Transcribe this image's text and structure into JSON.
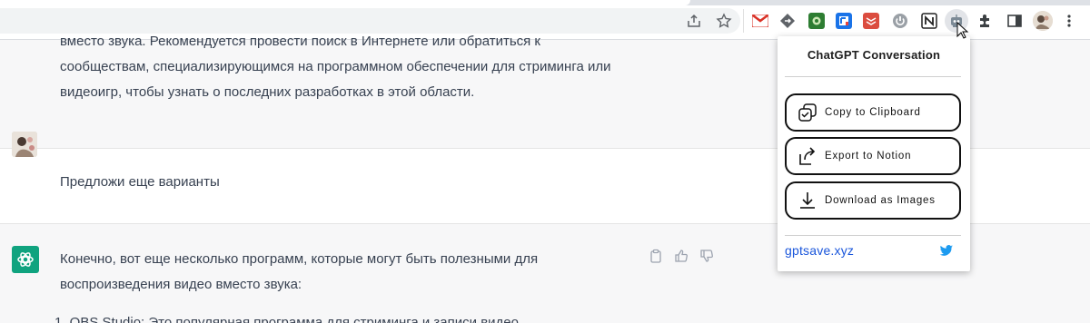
{
  "chat": {
    "assistant_previous": {
      "lines": [
        "вместо звука. Рекомендуется провести поиск в Интернете или обратиться к",
        "сообществам, специализирующимся на программном обеспечении для стриминга или",
        "видеоигр, чтобы узнать о последних разработках в этой области."
      ]
    },
    "user_message": "Предложи еще варианты",
    "assistant_reply": {
      "lines": [
        "Конечно, вот еще несколько программ, которые могут быть полезными для",
        "воспроизведения видео вместо звука:"
      ],
      "list_item_partial": "1.  OBS Studio: Это популярная программа для стриминга и записи видео"
    }
  },
  "popup": {
    "title": "ChatGPT Conversation",
    "buttons": [
      {
        "label": "Copy to Clipboard",
        "icon": "copy-icon"
      },
      {
        "label": "Export to Notion",
        "icon": "export-icon"
      },
      {
        "label": "Download as Images",
        "icon": "download-icon"
      }
    ],
    "link": "gptsave.xyz",
    "link_icon": "twitter-icon"
  },
  "toolbar": {
    "icons": [
      "share-icon",
      "star-icon"
    ],
    "extensions": [
      "gmail-icon",
      "extension-arrow-icon",
      "evernote-like-icon",
      "rss-icon",
      "todoist-icon",
      "power-icon",
      "notion-icon",
      "chatgpt-robot-icon",
      "puzzle-icon",
      "sidepanel-icon",
      "profile-avatar",
      "menu-icon"
    ]
  },
  "colors": {
    "gpt_green": "#10a37f",
    "link_blue": "#1a56db",
    "twitter_blue": "#1d9bf0",
    "assistant_bg": "#f7f7f8"
  }
}
